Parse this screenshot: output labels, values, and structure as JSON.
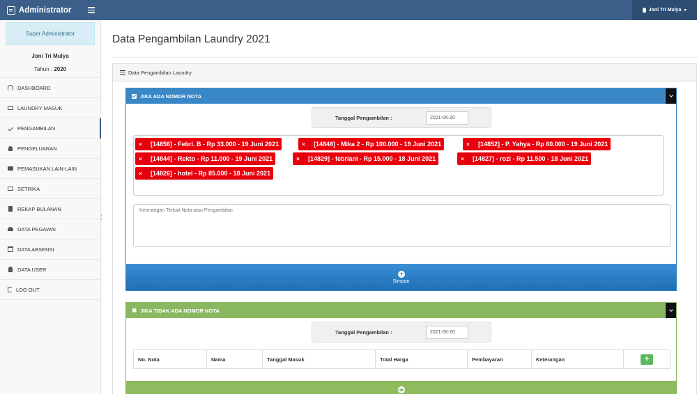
{
  "app": {
    "title": "Administrator"
  },
  "topbar": {
    "user": "Joni Tri Mulya"
  },
  "sidebar": {
    "role": "Super Administrator",
    "name": "Joni Tri Mulya",
    "year_label": "Tahun : ",
    "year": "2020",
    "items": [
      {
        "label": "DASHBOARD",
        "icon": "dashboard-icon"
      },
      {
        "label": "LAUNDRY MASUK",
        "icon": "monitor-icon"
      },
      {
        "label": "PENGAMBILAN",
        "icon": "check-icon"
      },
      {
        "label": "PENGELUARAN",
        "icon": "bell-icon"
      },
      {
        "label": "PEMASUKAN LAIN-LAIN",
        "icon": "credit-card-icon"
      },
      {
        "label": "SETRIKA",
        "icon": "money-icon"
      },
      {
        "label": "REKAP BULANAN",
        "icon": "file-icon"
      },
      {
        "label": "DATA PEGAWAI",
        "icon": "users-icon"
      },
      {
        "label": "DATA ABSENSI",
        "icon": "calendar-icon"
      },
      {
        "label": "DATA USER",
        "icon": "user-icon"
      },
      {
        "label": "LOG OUT",
        "icon": "logout-icon"
      }
    ]
  },
  "page": {
    "title": "Data Pengambilan Laundry 2021",
    "panel_title": "Data Pengambilan Laundry"
  },
  "section1": {
    "title": "JIKA ADA NOMOR NOTA",
    "date_label": "Tanggal Pengambilan :",
    "date_value": "2021-06-20",
    "tags": [
      "[14856] - Febri. B - Rp 33.000 - 19 Juni 2021",
      "[14848] - Mika 2 - Rp 100.000 - 19 Juni 2021",
      "[14852] - P. Yahya - Rp 60.000 - 19 Juni 2021",
      "[14844] - Rekto - Rp 11.000 - 19 Juni 2021",
      "[14829] - febriani - Rp 15.000 - 18 Juni 2021",
      "[14827] - rozi - Rp 11.500 - 18 Juni 2021",
      "[14826] - hotel - Rp 85.000 - 18 Juni 2021"
    ],
    "tag_remove": "×",
    "note_placeholder": "Keterangan Terkait Nota atau Pengambilan",
    "save_label": "Simpan"
  },
  "section2": {
    "title": "JIKA TIDAK ADA NOMOR NOTA",
    "close_symbol": "✖",
    "date_label": "Tanggal Pengambilan :",
    "date_value": "2021-06-20",
    "columns": [
      "No. Nota",
      "Nama",
      "Tanggal Masuk",
      "Total Harga",
      "Pembayaran",
      "Keterangan"
    ],
    "add_symbol": "+"
  }
}
